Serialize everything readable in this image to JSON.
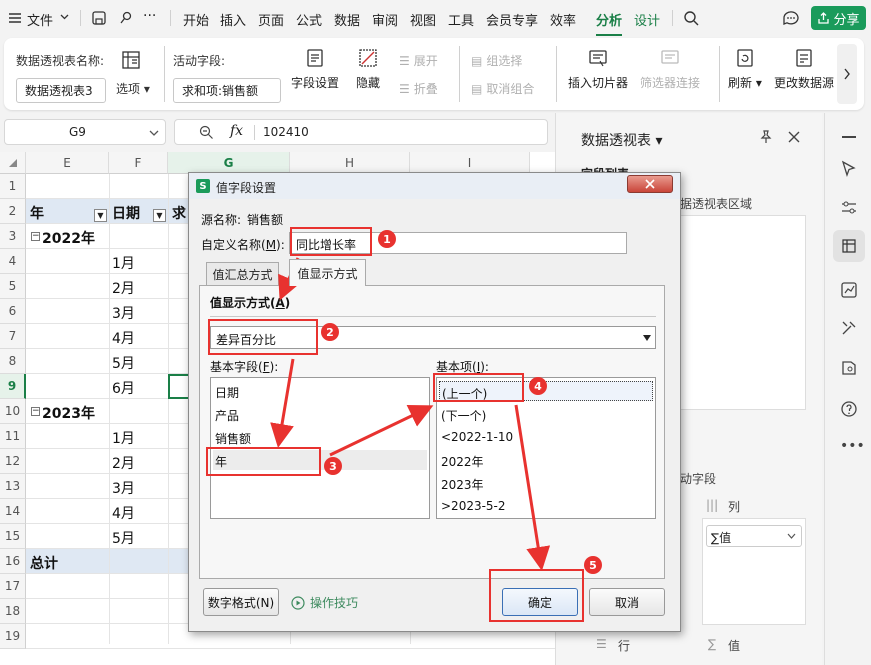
{
  "menubar": {
    "file": "文件",
    "tabs": [
      "开始",
      "插入",
      "页面",
      "公式",
      "数据",
      "审阅",
      "视图",
      "工具",
      "会员专享",
      "效率",
      "分析",
      "设计"
    ],
    "share": "分享"
  },
  "ribbon": {
    "pivot_name_label": "数据透视表名称:",
    "pivot_name_value": "数据透视表3",
    "options": "选项",
    "active_field_label": "活动字段:",
    "active_field_value": "求和项:销售额",
    "field_settings": "字段设置",
    "hide": "隐藏",
    "expand": "展开",
    "collapse": "折叠",
    "group_select": "组选择",
    "ungroup": "取消组合",
    "insert_slicer": "插入切片器",
    "filter_connection": "筛选器连接",
    "refresh": "刷新",
    "change_source": "更改数据源"
  },
  "formula_bar": {
    "cell_ref": "G9",
    "fx": "fx",
    "value": "102410"
  },
  "sheet": {
    "columns": [
      "E",
      "F",
      "G",
      "H",
      "I"
    ],
    "rows": [
      "1",
      "2",
      "3",
      "4",
      "5",
      "6",
      "7",
      "8",
      "9",
      "10",
      "11",
      "12",
      "13",
      "14",
      "15",
      "16",
      "17",
      "18",
      "19"
    ],
    "headers": {
      "year": "年",
      "date": "日期",
      "sum": "求"
    },
    "y2022": "2022年",
    "y2023": "2023年",
    "months_2022": [
      "1月",
      "2月",
      "3月",
      "4月",
      "5月",
      "6月"
    ],
    "months_2023": [
      "1月",
      "2月",
      "3月",
      "4月",
      "5月"
    ],
    "total": "总计"
  },
  "pane": {
    "title": "数据透视表",
    "section_fields": "字段列表",
    "drag_hint": "据透视表区域",
    "fields_label": "动字段",
    "columns_label": "列",
    "values_chip": "∑值",
    "rows_label": "行",
    "values_label": "值"
  },
  "dialog": {
    "title": "值字段设置",
    "source_label": "源名称:",
    "source_value": "销售额",
    "custom_name_label": "自定义名称(",
    "custom_name_key": "M",
    "custom_name_value": "同比增长率",
    "tab_summarize": "值汇总方式",
    "tab_show_values": "值显示方式",
    "show_values_label": "值显示方式(",
    "show_values_key": "A",
    "show_values_selected": "差异百分比",
    "base_field_label": "基本字段(",
    "base_field_key": "F",
    "base_fields": [
      "日期",
      "产品",
      "销售额",
      "年"
    ],
    "base_item_label": "基本项(",
    "base_item_key": "I",
    "base_items": [
      "(上一个)",
      "(下一个)",
      "<2022-1-10",
      "2022年",
      "2023年",
      ">2023-5-2"
    ],
    "number_format": "数字格式(N)",
    "tips": "操作技巧",
    "ok": "确定",
    "cancel": "取消"
  },
  "annotations": {
    "badges": [
      "1",
      "2",
      "3",
      "4",
      "5"
    ],
    "color": "#e8322f"
  },
  "colors": {
    "accent": "#1a7f47",
    "share_button": "#1a9b5b"
  }
}
